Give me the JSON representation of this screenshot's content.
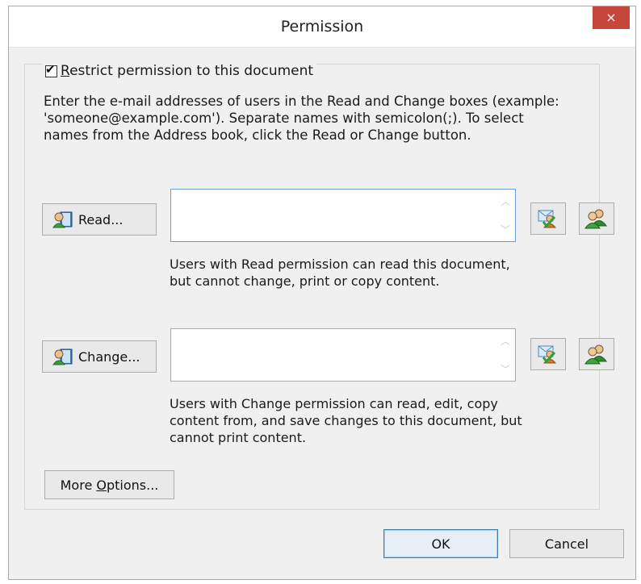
{
  "window": {
    "title": "Permission",
    "close_glyph": "×"
  },
  "restrict": {
    "checked": true,
    "label_underlined": "R",
    "label_rest": "estrict permission to this document"
  },
  "instructions": "Enter the e-mail addresses of users in the Read and Change boxes (example:\n'someone@example.com'). Separate names with semicolon(;). To select\nnames from the Address book, click the Read or Change button.",
  "read": {
    "button_label": "Read...",
    "field_value": "",
    "description": "Users with Read permission can read this document,\nbut cannot change, print or copy content."
  },
  "change": {
    "button_label": "Change...",
    "field_value": "",
    "description": "Users with Change permission can read, edit, copy\ncontent from, and save changes to this document, but\ncannot print content."
  },
  "more_options": {
    "label_pre": "More ",
    "label_underlined": "O",
    "label_post": "ptions..."
  },
  "footer": {
    "ok_label": "OK",
    "cancel_label": "Cancel"
  },
  "colors": {
    "accent": "#3c7fb1",
    "close": "#c7463c",
    "dialog_bg": "#f0f0f0"
  },
  "icons": {
    "role_button": "address-book-icon",
    "verify": "check-names-icon",
    "users": "users-icon"
  }
}
